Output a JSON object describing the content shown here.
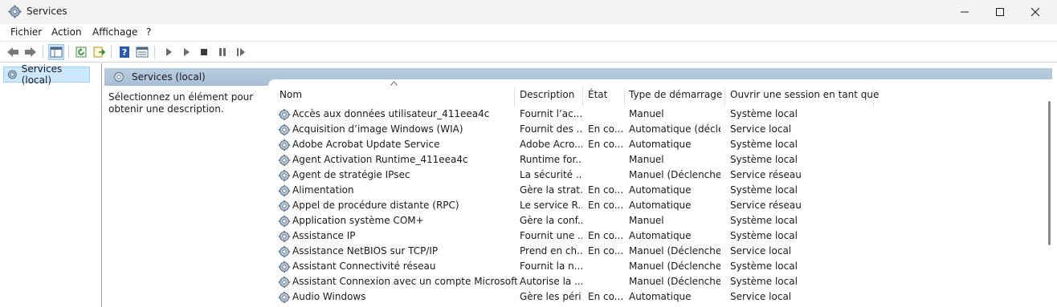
{
  "window": {
    "title": "Services"
  },
  "menu": [
    "Fichier",
    "Action",
    "Affichage",
    "?"
  ],
  "toolbar": {
    "icons": [
      "back-arrow-icon",
      "forward-arrow-icon",
      "show-hide-tree-icon",
      "refresh-icon",
      "export-list-icon",
      "help-icon",
      "properties-icon",
      "start-service-icon",
      "start-alt-icon",
      "stop-service-icon",
      "pause-service-icon",
      "restart-service-icon"
    ]
  },
  "tree": {
    "root_label": "Services (local)"
  },
  "panel": {
    "header": "Services (local)",
    "description": "Sélectionnez un élément pour obtenir une description."
  },
  "table": {
    "columns": [
      "Nom",
      "Description",
      "État",
      "Type de démarrage",
      "Ouvrir une session en tant que"
    ],
    "rows": [
      {
        "name": "Accès aux données utilisateur_411eea4c",
        "desc": "Fournit l’ac...",
        "etat": "",
        "type": "Manuel",
        "logon": "Système local"
      },
      {
        "name": "Acquisition d’image Windows (WIA)",
        "desc": "Fournit des ...",
        "etat": "En co...",
        "type": "Automatique (décle...",
        "logon": "Service local"
      },
      {
        "name": "Adobe Acrobat Update Service",
        "desc": "Adobe Acro...",
        "etat": "En co...",
        "type": "Automatique",
        "logon": "Système local"
      },
      {
        "name": "Agent Activation Runtime_411eea4c",
        "desc": "Runtime for...",
        "etat": "",
        "type": "Manuel",
        "logon": "Système local"
      },
      {
        "name": "Agent de stratégie IPsec",
        "desc": "La sécurité ...",
        "etat": "",
        "type": "Manuel (Déclenche...",
        "logon": "Service réseau"
      },
      {
        "name": "Alimentation",
        "desc": "Gère la strat...",
        "etat": "En co...",
        "type": "Automatique",
        "logon": "Système local"
      },
      {
        "name": "Appel de procédure distante (RPC)",
        "desc": "Le service R...",
        "etat": "En co...",
        "type": "Automatique",
        "logon": "Service réseau"
      },
      {
        "name": "Application système COM+",
        "desc": "Gère la conf...",
        "etat": "",
        "type": "Manuel",
        "logon": "Système local"
      },
      {
        "name": "Assistance IP",
        "desc": "Fournit une ...",
        "etat": "En co...",
        "type": "Automatique",
        "logon": "Système local"
      },
      {
        "name": "Assistance NetBIOS sur TCP/IP",
        "desc": "Prend en ch...",
        "etat": "En co...",
        "type": "Manuel (Déclenche...",
        "logon": "Service local"
      },
      {
        "name": "Assistant Connectivité réseau",
        "desc": "Fournit la n...",
        "etat": "",
        "type": "Manuel (Déclenche...",
        "logon": "Système local"
      },
      {
        "name": "Assistant Connexion avec un compte Microsoft",
        "desc": "Autorise la ...",
        "etat": "",
        "type": "Manuel (Déclenche...",
        "logon": "Système local"
      },
      {
        "name": "Audio Windows",
        "desc": "Gère les péri...",
        "etat": "En co...",
        "type": "Automatique",
        "logon": "Service local"
      }
    ]
  }
}
